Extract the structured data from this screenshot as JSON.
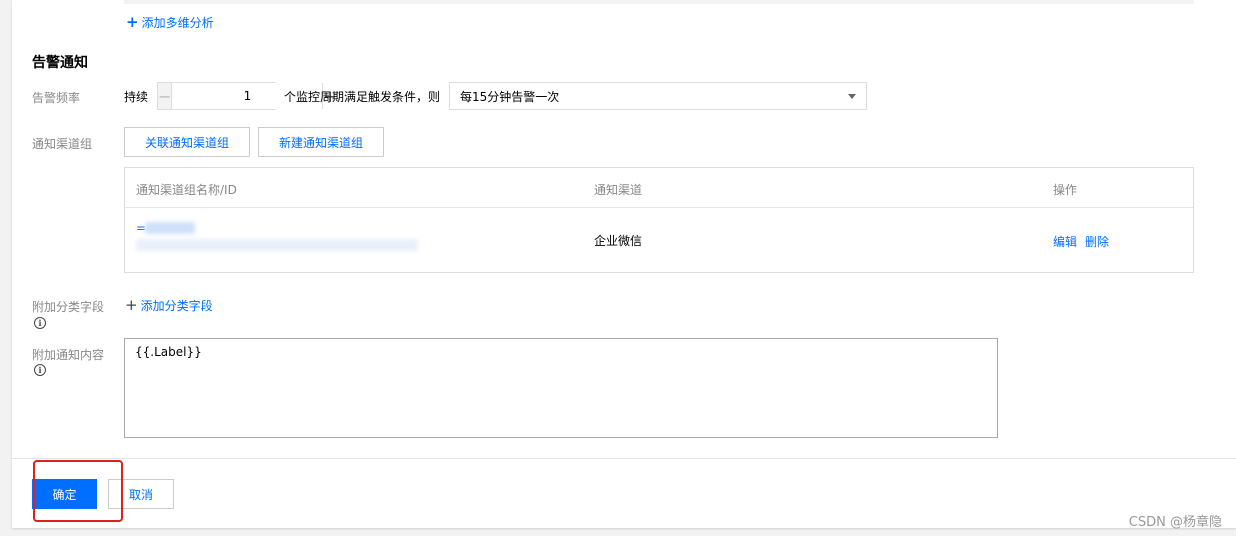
{
  "top_link": {
    "label": "添加多维分析"
  },
  "section": {
    "title": "告警通知"
  },
  "frequency": {
    "label": "告警频率",
    "prefix": "持续",
    "value": "1",
    "suffix": "个监控周期满足触发条件，则",
    "selected": "每15分钟告警一次"
  },
  "channel_group": {
    "label": "通知渠道组",
    "link_button": "关联通知渠道组",
    "new_button": "新建通知渠道组",
    "table": {
      "columns": [
        "通知渠道组名称/ID",
        "通知渠道",
        "操作"
      ],
      "rows": [
        {
          "name_prefix": "=",
          "channel": "企业微信",
          "edit": "编辑",
          "delete": "删除"
        }
      ]
    }
  },
  "extra_fields": {
    "label": "附加分类字段",
    "add_link": "添加分类字段"
  },
  "extra_content": {
    "label": "附加通知内容",
    "value": "{{.Label}}"
  },
  "footer": {
    "confirm": "确定",
    "cancel": "取消"
  },
  "watermark": "CSDN @杨章隐",
  "colors": {
    "primary": "#006eff",
    "highlight": "#e02020"
  }
}
